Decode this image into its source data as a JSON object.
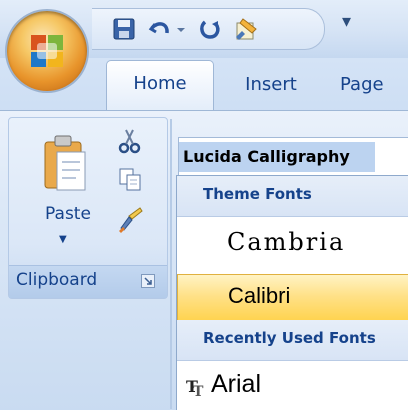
{
  "quick_access": {
    "icons": [
      "save-icon",
      "undo-icon",
      "undo-dropdown-icon",
      "redo-icon",
      "paint-icon",
      "customize-icon"
    ]
  },
  "tabs": [
    {
      "label": "Home",
      "active": true
    },
    {
      "label": "Insert",
      "active": false
    },
    {
      "label": "Page",
      "active": false
    }
  ],
  "clipboard": {
    "group_label": "Clipboard",
    "paste_label": "Paste",
    "icons": [
      "paste-icon",
      "cut-icon",
      "copy-icon",
      "format-painter-icon",
      "dialog-launcher-icon"
    ]
  },
  "font_box": {
    "value": "Lucida Calligraphy"
  },
  "font_dropdown": {
    "theme_header": "Theme Fonts",
    "theme_fonts": [
      "Cambria",
      "Calibri"
    ],
    "selected": "Calibri",
    "recent_header": "Recently Used Fonts",
    "recent_fonts": [
      "Arial"
    ]
  },
  "colors": {
    "accent_text": "#15428b",
    "hover_highlight": "#ffd34e",
    "ribbon_blue": "#c9dbf1"
  }
}
